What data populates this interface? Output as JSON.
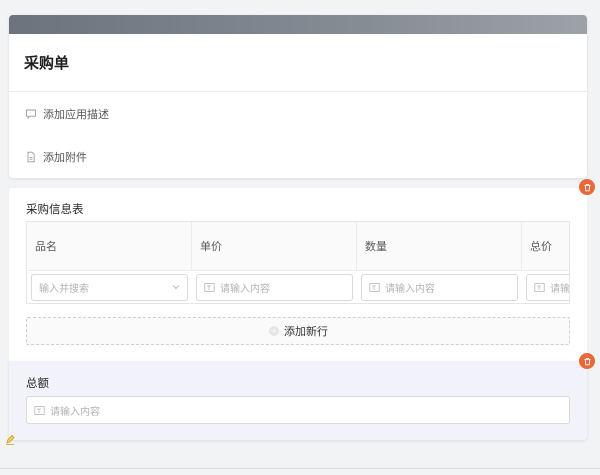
{
  "form": {
    "title": "采购单",
    "add_description": "添加应用描述",
    "add_attachment": "添加附件"
  },
  "table_section": {
    "label": "采购信息表",
    "columns": [
      "品名",
      "单价",
      "数量",
      "总价"
    ],
    "row": {
      "product_placeholder": "输入并搜索",
      "price_placeholder": "请输入内容",
      "quantity_placeholder": "请输入内容",
      "total_placeholder": "请输入内容"
    },
    "add_row_label": "添加新行"
  },
  "total_section": {
    "label": "总额",
    "placeholder": "请输入内容"
  },
  "colors": {
    "accent_delete": "#e8683a",
    "header_bar": "#6c737d",
    "selected_section_bg": "#f2f2fb"
  }
}
